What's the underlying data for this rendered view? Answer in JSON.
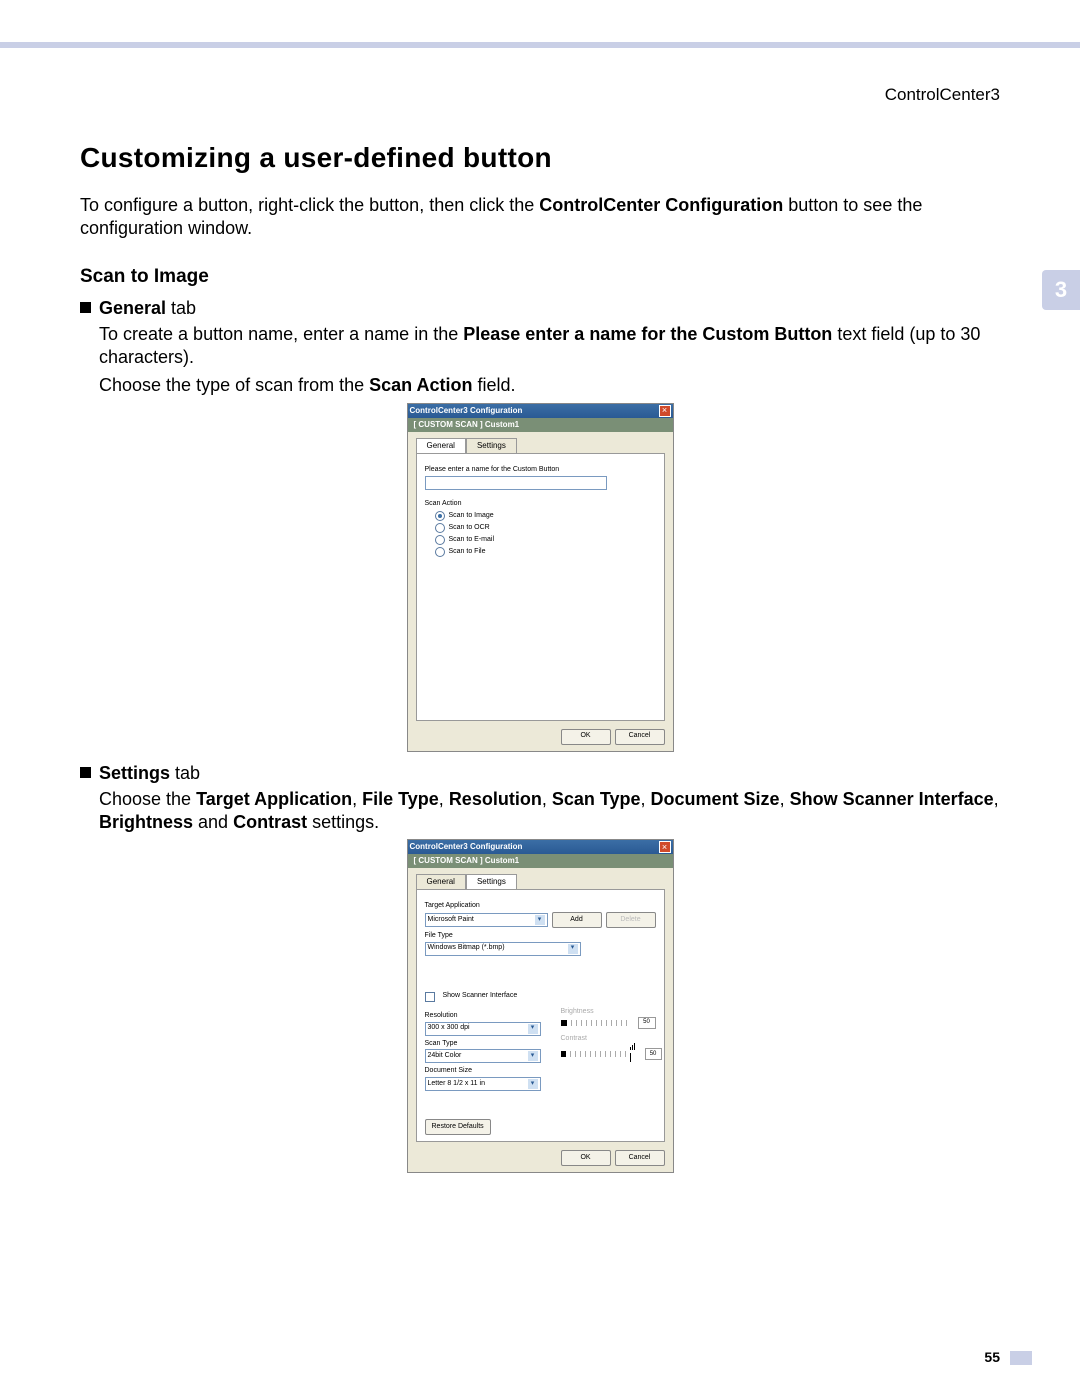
{
  "page": {
    "header_right": "ControlCenter3",
    "chapter_number": "3",
    "page_number": "55"
  },
  "heading": "Customizing a user-defined button",
  "intro": {
    "pre": "To configure a button, right-click the button, then click the ",
    "bold": "ControlCenter Configuration",
    "post": " button to see the configuration window."
  },
  "sub_heading": "Scan to Image",
  "general_tab": {
    "bullet_bold": "General",
    "bullet_rest": " tab",
    "l1a": "To create a button name, enter a name in the ",
    "l1b": "Please enter a name for the Custom Button",
    "l1c": " text field (up to 30 characters).",
    "l2a": "Choose the type of scan from the ",
    "l2b": "Scan Action",
    "l2c": " field."
  },
  "settings_tab": {
    "bullet_bold": "Settings",
    "bullet_rest": " tab",
    "l1a": "Choose the ",
    "b1": "Target Application",
    "c1": ", ",
    "b2": "File Type",
    "c2": ", ",
    "b3": "Resolution",
    "c3": ", ",
    "b4": "Scan Type",
    "c4": ", ",
    "b5": "Document Size",
    "c5": ", ",
    "b6": "Show Scanner Interface",
    "c6": ", ",
    "b7": "Brightness",
    "c7": " and ",
    "b8": "Contrast",
    "c8": " settings."
  },
  "dialog1": {
    "title": "ControlCenter3 Configuration",
    "subheader": "[ CUSTOM SCAN ]  Custom1",
    "tab_general": "General",
    "tab_settings": "Settings",
    "lbl_name": "Please enter a name for the Custom Button",
    "lbl_action": "Scan Action",
    "opt1": "Scan to Image",
    "opt2": "Scan to OCR",
    "opt3": "Scan to E-mail",
    "opt4": "Scan to File",
    "btn_ok": "OK",
    "btn_cancel": "Cancel"
  },
  "dialog2": {
    "title": "ControlCenter3 Configuration",
    "subheader": "[ CUSTOM SCAN ]  Custom1",
    "tab_general": "General",
    "tab_settings": "Settings",
    "lbl_target": "Target Application",
    "val_target": "Microsoft Paint",
    "btn_add": "Add",
    "btn_delete": "Delete",
    "lbl_filetype": "File Type",
    "val_filetype": "Windows Bitmap (*.bmp)",
    "lbl_show": "Show Scanner Interface",
    "lbl_res": "Resolution",
    "val_res": "300 x 300 dpi",
    "lbl_scantype": "Scan Type",
    "val_scantype": "24bit Color",
    "lbl_docsize": "Document Size",
    "val_docsize": "Letter 8 1/2 x 11 in",
    "lbl_bright": "Brightness",
    "val_bright": "50",
    "lbl_contrast": "Contrast",
    "val_contrast": "50",
    "btn_restore": "Restore Defaults",
    "btn_ok": "OK",
    "btn_cancel": "Cancel"
  }
}
